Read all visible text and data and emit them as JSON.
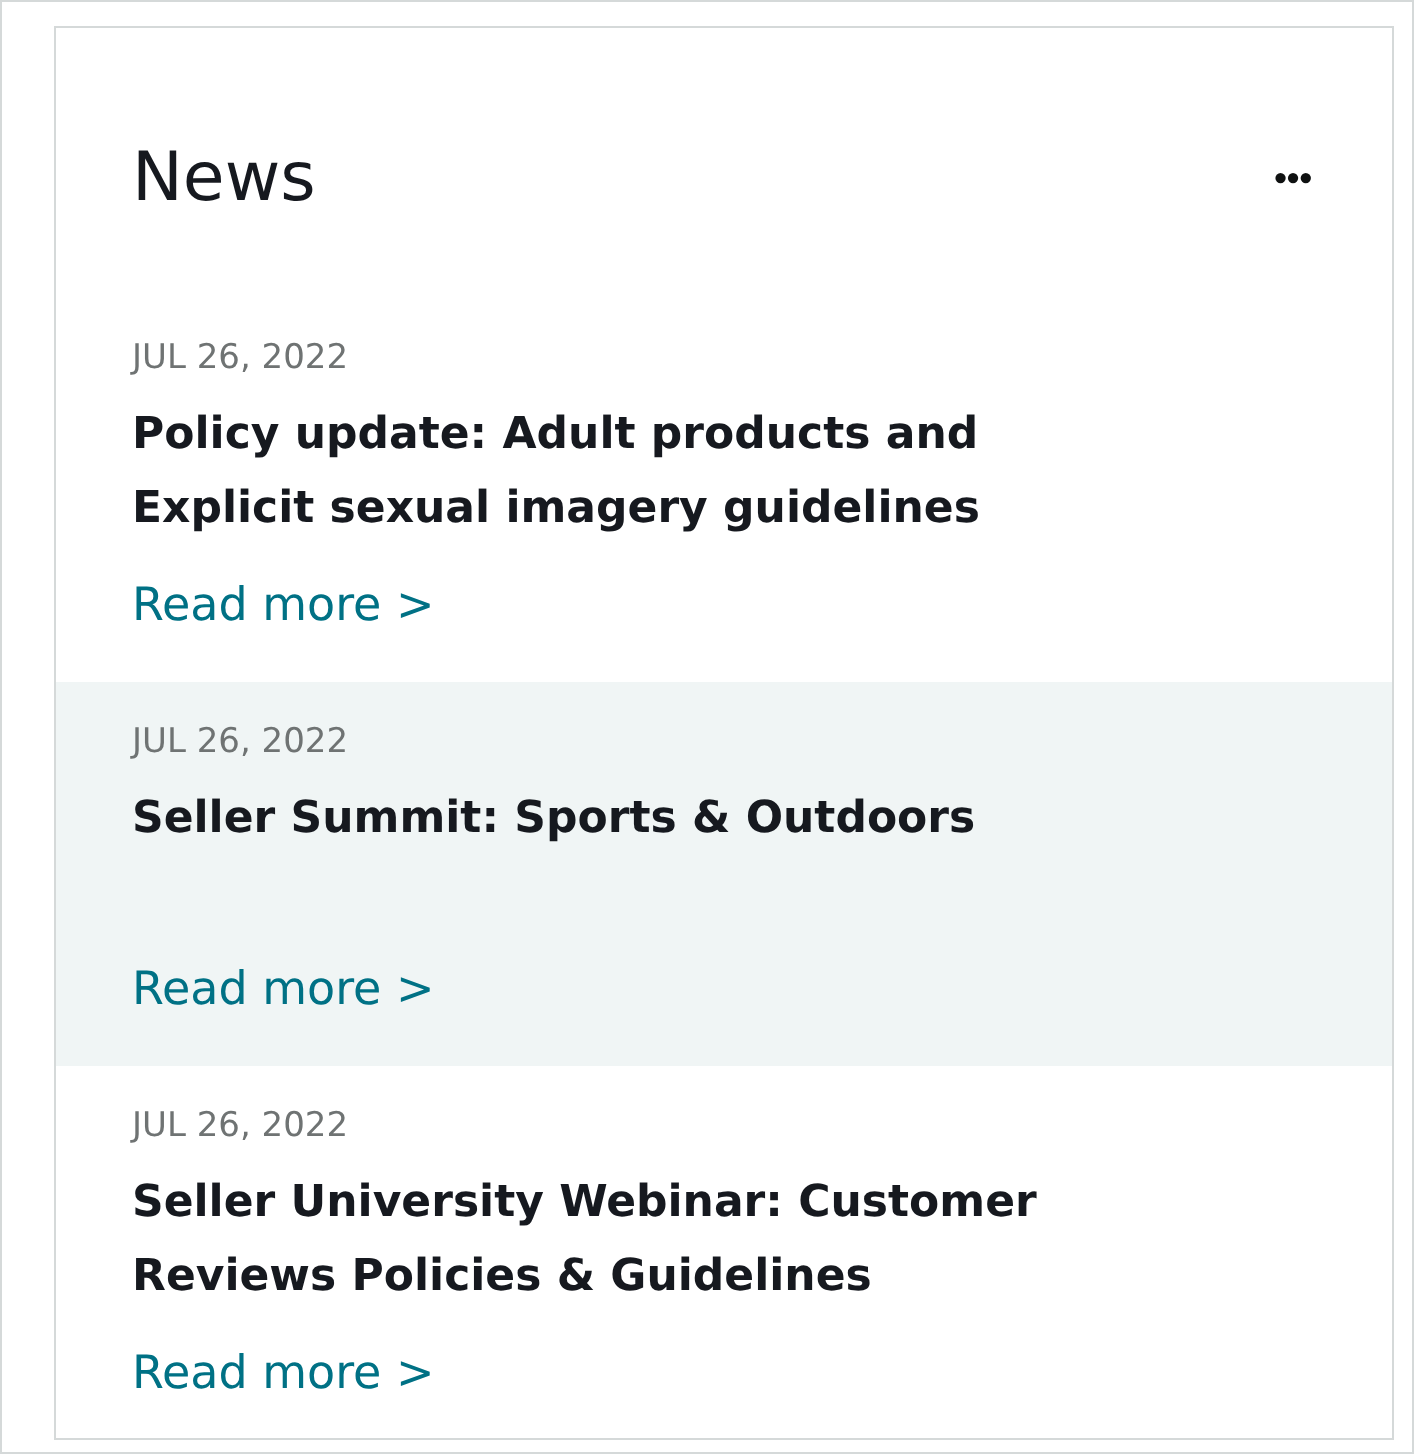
{
  "widget": {
    "title": "News",
    "menu_icon": "•••"
  },
  "items": [
    {
      "date": "JUL 26, 2022",
      "title": "Policy update: Adult products and Explicit sexual imagery guidelines",
      "link": "Read more >",
      "highlighted": false
    },
    {
      "date": "JUL 26, 2022",
      "title": "Seller Summit: Sports & Outdoors",
      "link": "Read more >",
      "highlighted": true
    },
    {
      "date": "JUL 26, 2022",
      "title": "Seller University Webinar: Customer Reviews Policies & Guidelines",
      "link": "Read more >",
      "highlighted": false
    }
  ]
}
